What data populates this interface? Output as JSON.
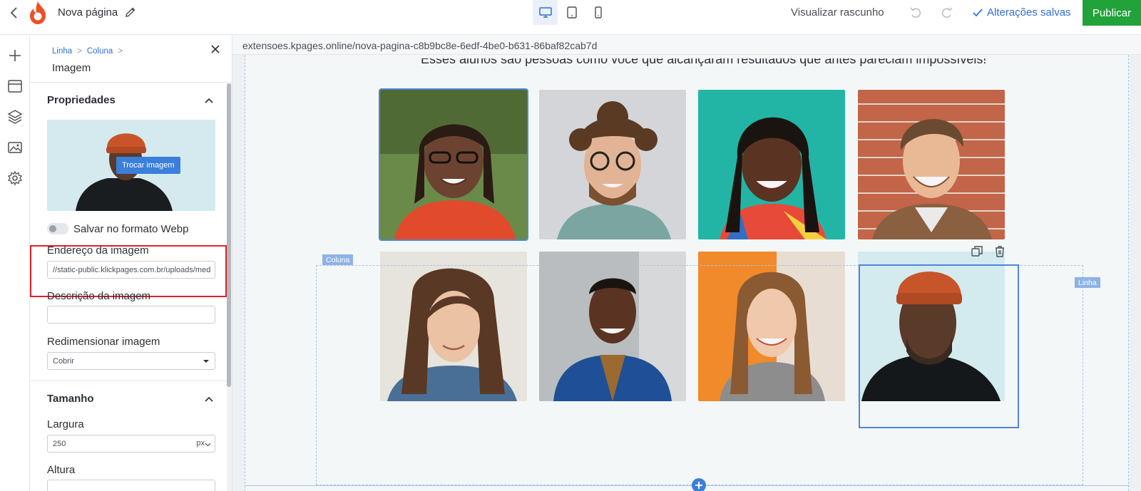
{
  "topbar": {
    "page_name": "Nova página",
    "preview_label": "Visualizar rascunho",
    "saved_label": "Alterações salvas",
    "publish_label": "Publicar",
    "devices": [
      "desktop-icon",
      "tablet-icon",
      "mobile-icon"
    ],
    "active_device": "desktop"
  },
  "rail": {
    "icons": [
      "plus-icon",
      "window-icon",
      "layers-icon",
      "image-gallery-icon",
      "gear-icon"
    ]
  },
  "panel": {
    "breadcrumb": [
      "Linha",
      "Coluna"
    ],
    "breadcrumb_sep": ">",
    "title": "Imagem",
    "properties_heading": "Propriedades",
    "swap_image_label": "Trocar imagem",
    "webp_label": "Salvar no formato Webp",
    "webp_enabled": false,
    "image_url_label": "Endereço da imagem",
    "image_url_value": "//static-public.klickpages.com.br/uploads/med",
    "image_desc_label": "Descrição da imagem",
    "image_desc_value": "",
    "resize_label": "Redimensionar imagem",
    "resize_value": "Cobrir",
    "size_heading": "Tamanho",
    "width_label": "Largura",
    "width_value": "250",
    "width_unit": "px",
    "height_label": "Altura"
  },
  "canvas": {
    "url": "extensoes.kpages.online/nova-pagina-c8b9bc8e-6edf-4be0-b631-86baf82cab7d",
    "headline": "Esses alunos são pessoas como você que alcançaram resultados que antes pareciam impossíveis!",
    "column_tag": "Coluna",
    "row_tag": "Linha"
  },
  "colors": {
    "accent": "#2e6fd6",
    "publish": "#22a33a",
    "highlight": "#e0232b",
    "selection": "#4f86d9"
  }
}
